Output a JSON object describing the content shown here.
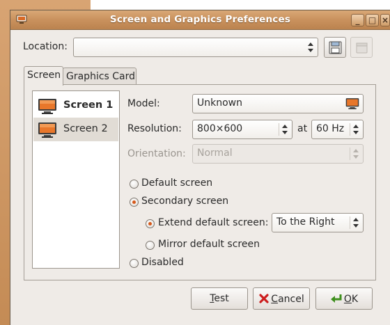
{
  "window": {
    "title": "Screen and Graphics Preferences"
  },
  "titlebar_buttons": {
    "minimize": "_",
    "maximize": "□",
    "close": "×"
  },
  "location": {
    "label": "Location:",
    "value": ""
  },
  "tabs": [
    {
      "label": "Screen",
      "active": true
    },
    {
      "label": "Graphics Card",
      "active": false
    }
  ],
  "screens": [
    {
      "label": "Screen 1",
      "bold": true,
      "selected": false
    },
    {
      "label": "Screen 2",
      "bold": false,
      "selected": true
    }
  ],
  "form": {
    "model_label": "Model:",
    "model_value": "Unknown",
    "resolution_label": "Resolution:",
    "resolution_value": "800×600",
    "at_label": "at",
    "refresh_value": "60 Hz",
    "orientation_label": "Orientation:",
    "orientation_value": "Normal",
    "default_screen": "Default screen",
    "secondary_screen": "Secondary screen",
    "extend_label": "Extend default screen:",
    "extend_value": "To the Right",
    "mirror_label": "Mirror default screen",
    "disabled_label": "Disabled",
    "selected_mode": "secondary",
    "selected_secondary_option": "extend"
  },
  "buttons": {
    "test_prefix": "",
    "test_mnemonic": "T",
    "test_rest": "est",
    "cancel_mnemonic": "C",
    "cancel_rest": "ancel",
    "ok_mnemonic": "O",
    "ok_rest": "K"
  },
  "colors": {
    "accent": "#d5581a",
    "titlebar": "#c9915d",
    "window_bg": "#efebe7"
  },
  "icons": {
    "titlebar": "monitor-icon",
    "save": "save-icon",
    "delete": "delete-icon",
    "cancel": "cancel-icon",
    "ok": "ok-arrow-icon"
  }
}
